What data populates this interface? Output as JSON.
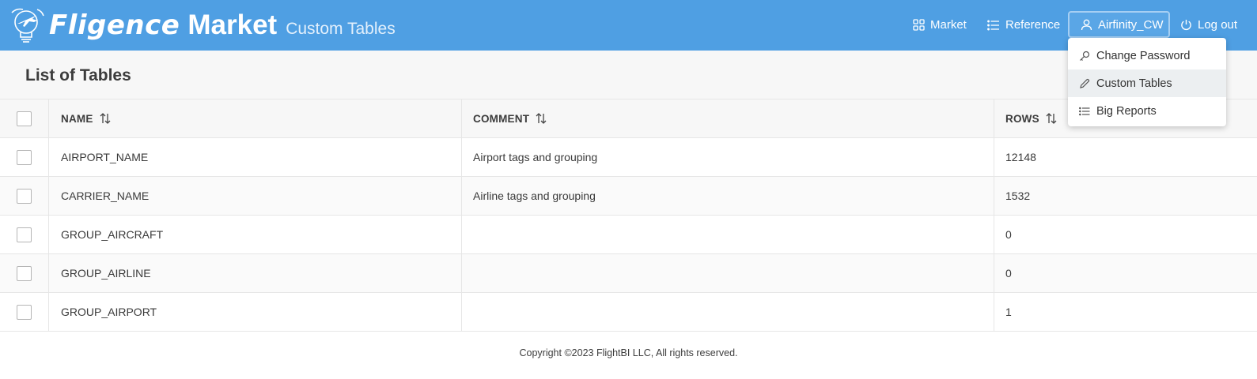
{
  "header": {
    "brand_word1": "Fligence",
    "brand_word2": "Market",
    "subtitle": "Custom Tables",
    "nav": {
      "market": "Market",
      "reference": "Reference",
      "user": "Airfinity_CW",
      "logout": "Log out"
    }
  },
  "user_menu": {
    "items": [
      {
        "label": "Change Password",
        "icon": "key-icon"
      },
      {
        "label": "Custom Tables",
        "icon": "pencil-icon"
      },
      {
        "label": "Big Reports",
        "icon": "list-icon"
      }
    ]
  },
  "page": {
    "title": "List of Tables"
  },
  "table": {
    "columns": {
      "name": "NAME",
      "comment": "COMMENT",
      "rows": "ROWS"
    },
    "rows": [
      {
        "name": "AIRPORT_NAME",
        "comment": "Airport tags and grouping",
        "rows": "12148"
      },
      {
        "name": "CARRIER_NAME",
        "comment": "Airline tags and grouping",
        "rows": "1532"
      },
      {
        "name": "GROUP_AIRCRAFT",
        "comment": "",
        "rows": "0"
      },
      {
        "name": "GROUP_AIRLINE",
        "comment": "",
        "rows": "0"
      },
      {
        "name": "GROUP_AIRPORT",
        "comment": "",
        "rows": "1"
      }
    ]
  },
  "footer": {
    "copyright": "Copyright ©2023 FlightBI LLC, All rights reserved."
  },
  "colors": {
    "header_bg": "#4f9fe3",
    "active_menu_bg": "#eceff1"
  }
}
